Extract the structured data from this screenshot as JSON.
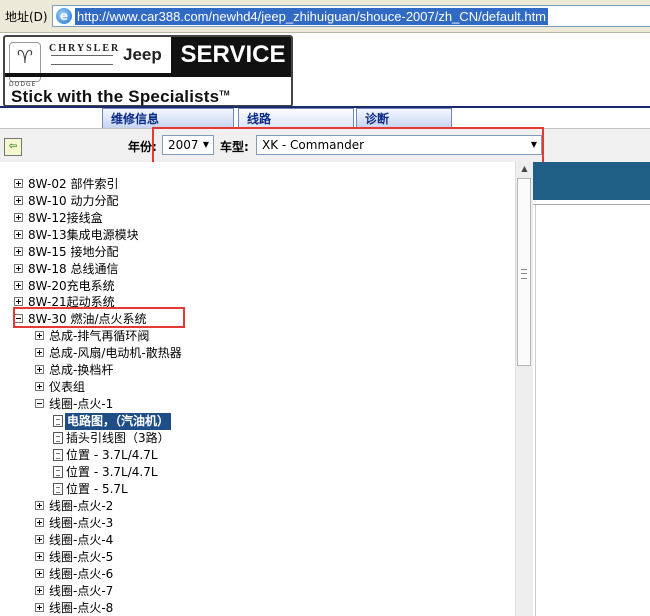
{
  "address_bar": {
    "label": "地址(D)",
    "url": "http://www.car388.com/newhd4/jeep_zhihuiguan/shouce-2007/zh_CN/default.htm"
  },
  "header": {
    "brands": [
      "DODGE",
      "CHRYSLER",
      "Jeep"
    ],
    "service": "SERVICE",
    "slogan": "Stick with the Specialists",
    "slogan_tm": "TM"
  },
  "tabs": [
    {
      "label": "维修信息",
      "active": false
    },
    {
      "label": "线路",
      "active": true
    },
    {
      "label": "诊断",
      "active": false
    }
  ],
  "toolbar": {
    "year_label": "年份:",
    "year_value": "2007",
    "model_label": "车型:",
    "model_value": "XK - Commander"
  },
  "tree": {
    "top": [
      {
        "code": "8W-02",
        "name": "部件索引"
      },
      {
        "code": "8W-10",
        "name": "动力分配"
      },
      {
        "code": "8W-12",
        "name": "接线盒"
      },
      {
        "code": "8W-13",
        "name": "集成电源模块"
      },
      {
        "code": "8W-15",
        "name": "接地分配"
      },
      {
        "code": "8W-18",
        "name": "总线通信"
      },
      {
        "code": "8W-20",
        "name": "充电系统"
      },
      {
        "code": "8W-21",
        "name": "起动系统"
      }
    ],
    "expanded": {
      "code": "8W-30",
      "name": "燃油/点火系统"
    },
    "children_before": [
      "总成-排气再循环阀",
      "总成-风扇/电动机-散热器",
      "总成-换档杆",
      "仪表组"
    ],
    "coil1": "线圈-点火-1",
    "coil1_docs": [
      "电路图，（汽油机）",
      "插头引线图（3路）",
      "位置 - 3.7L/4.7L",
      "位置 - 3.7L/4.7L",
      "位置 - 5.7L"
    ],
    "coils_after": [
      "线圈-点火-2",
      "线圈-点火-3",
      "线圈-点火-4",
      "线圈-点火-5",
      "线圈-点火-6",
      "线圈-点火-7",
      "线圈-点火-8"
    ]
  },
  "colors": {
    "highlight": "#e53935",
    "selected": "#1f4e86",
    "tab_text": "#0a2a88"
  }
}
